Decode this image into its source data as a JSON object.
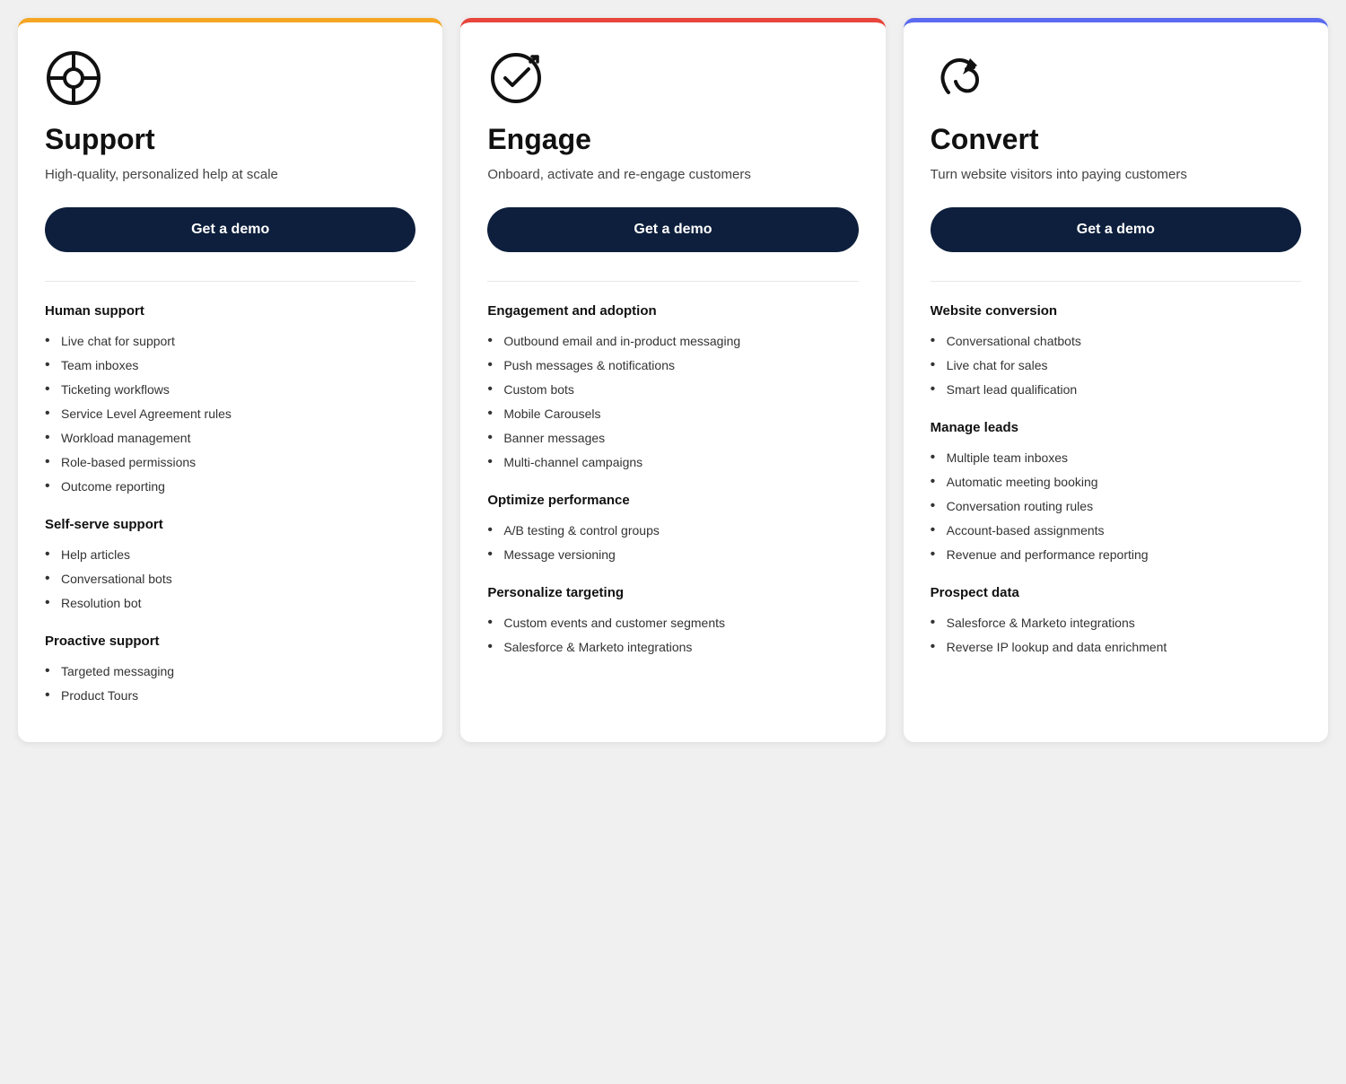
{
  "cards": [
    {
      "id": "support",
      "borderColor": "#f5a623",
      "icon": "support-icon",
      "title": "Support",
      "subtitle": "High-quality, personalized help at scale",
      "demoLabel": "Get a demo",
      "sections": [
        {
          "heading": "Human support",
          "items": [
            "Live chat for support",
            "Team inboxes",
            "Ticketing workflows",
            "Service Level Agreement rules",
            "Workload management",
            "Role-based permissions",
            "Outcome reporting"
          ]
        },
        {
          "heading": "Self-serve support",
          "items": [
            "Help articles",
            "Conversational bots",
            "Resolution bot"
          ]
        },
        {
          "heading": "Proactive support",
          "items": [
            "Targeted messaging",
            "Product Tours"
          ]
        }
      ]
    },
    {
      "id": "engage",
      "borderColor": "#e8453c",
      "icon": "engage-icon",
      "title": "Engage",
      "subtitle": "Onboard, activate and re-engage customers",
      "demoLabel": "Get a demo",
      "sections": [
        {
          "heading": "Engagement and adoption",
          "items": [
            "Outbound email and in-product messaging",
            "Push messages & notifications",
            "Custom bots",
            "Mobile Carousels",
            "Banner messages",
            "Multi-channel campaigns"
          ]
        },
        {
          "heading": "Optimize performance",
          "items": [
            "A/B testing & control groups",
            "Message versioning"
          ]
        },
        {
          "heading": "Personalize targeting",
          "items": [
            "Custom events and customer segments",
            "Salesforce & Marketo integrations"
          ]
        }
      ]
    },
    {
      "id": "convert",
      "borderColor": "#5b6af0",
      "icon": "convert-icon",
      "title": "Convert",
      "subtitle": "Turn website visitors into paying customers",
      "demoLabel": "Get a demo",
      "sections": [
        {
          "heading": "Website conversion",
          "items": [
            "Conversational chatbots",
            "Live chat for sales",
            "Smart lead qualification"
          ]
        },
        {
          "heading": "Manage leads",
          "items": [
            "Multiple team inboxes",
            "Automatic meeting booking",
            "Conversation routing rules",
            "Account-based assignments",
            "Revenue and performance reporting"
          ]
        },
        {
          "heading": "Prospect data",
          "items": [
            "Salesforce & Marketo integrations",
            "Reverse IP lookup and data enrichment"
          ]
        }
      ]
    }
  ]
}
